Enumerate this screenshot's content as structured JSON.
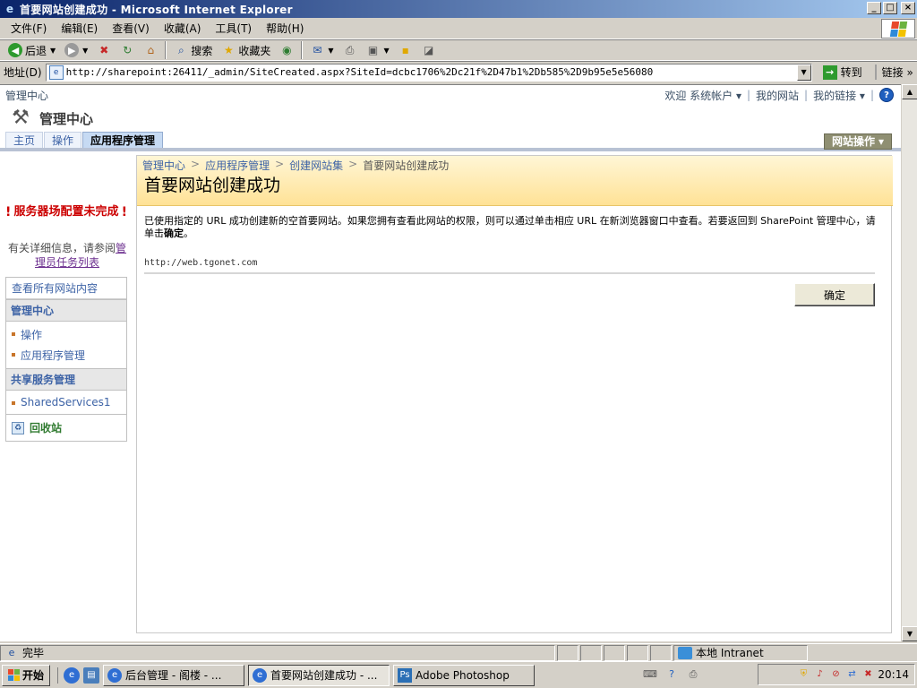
{
  "window": {
    "title": "首要网站创建成功 - Microsoft Internet Explorer",
    "buttons": {
      "minimize": "_",
      "maximize": "□",
      "close": "×"
    }
  },
  "menubar": {
    "items": [
      "文件(F)",
      "编辑(E)",
      "查看(V)",
      "收藏(A)",
      "工具(T)",
      "帮助(H)"
    ]
  },
  "toolbar": {
    "back": "后退",
    "search": "搜索",
    "favorites": "收藏夹"
  },
  "addressbar": {
    "label": "地址(D)",
    "url": "http://sharepoint:26411/_admin/SiteCreated.aspx?SiteId=dcbc1706%2Dc21f%2D47b1%2Db585%2D9b95e5e56080",
    "go": "转到",
    "links": "链接"
  },
  "sharepoint": {
    "site_name": "管理中心",
    "welcome": "欢迎 系统帐户",
    "my_site": "我的网站",
    "my_links": "我的链接",
    "help_glyph": "?",
    "header_title": "管理中心",
    "tabs": [
      "主页",
      "操作",
      "应用程序管理"
    ],
    "active_tab_index": 2,
    "site_actions": "网站操作",
    "left_nav": {
      "warning_title": "服务器场配置未完成",
      "warning_detail_prefix": "有关详细信息，请参阅",
      "warning_detail_link": "管理员任务列表",
      "view_all": "查看所有网站内容",
      "sections": [
        {
          "heading": "管理中心",
          "items": [
            "操作",
            "应用程序管理"
          ]
        },
        {
          "heading": "共享服务管理",
          "items": [
            "SharedServices1"
          ]
        }
      ],
      "recycle_bin": "回收站"
    },
    "breadcrumb": [
      "管理中心",
      "应用程序管理",
      "创建网站集",
      "首要网站创建成功"
    ],
    "page_title": "首要网站创建成功",
    "message_part1": "已使用指定的 URL 成功创建新的空首要网站。如果您拥有查看此网站的权限，则可以通过单击相应 URL 在新浏览器窗口中查看。若要返回到 SharePoint 管理中心，请单击",
    "message_bold": "确定",
    "message_end": "。",
    "site_url": "http://web.tgonet.com",
    "ok_button": "确定"
  },
  "statusbar": {
    "text": "完毕",
    "zone": "本地 Intranet"
  },
  "taskbar": {
    "start": "开始",
    "tasks": [
      {
        "label": "后台管理 - 阁楼 - ...",
        "active": false
      },
      {
        "label": "首要网站创建成功 - ...",
        "active": true
      },
      {
        "label": "Adobe Photoshop",
        "active": false
      }
    ],
    "clock": "20:14"
  },
  "colors": {
    "title_bar_start": "#0a246a",
    "title_area_bg": "#ffe296",
    "link_blue": "#3d63a6",
    "warning_red": "#cc0000",
    "site_actions_bg": "#8f8f72"
  }
}
